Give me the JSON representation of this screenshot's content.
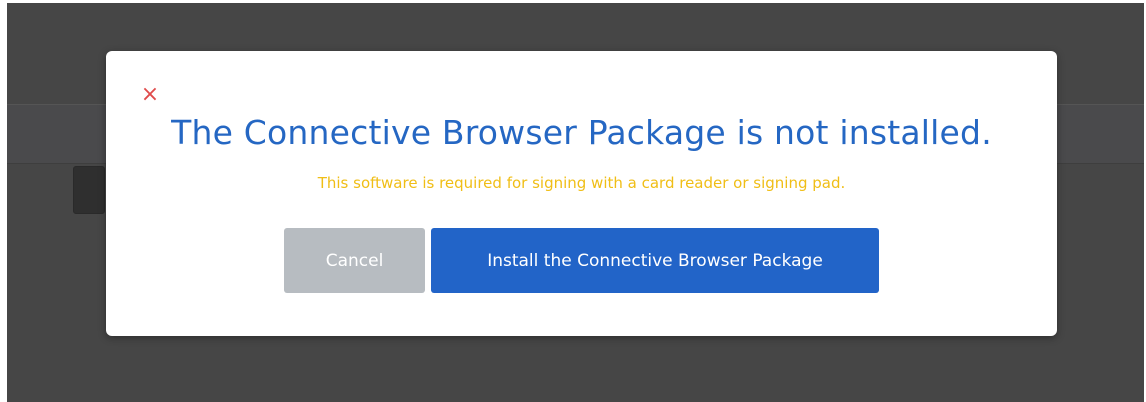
{
  "dialog": {
    "close_glyph": "×",
    "title": "The Connective Browser Package is not installed.",
    "message": "This software is required for signing with a card reader or signing pad.",
    "cancel_label": "Cancel",
    "install_label": "Install the Connective Browser Package"
  },
  "colors": {
    "overlay": "#464646",
    "title": "#2567c3",
    "message": "#f0be16",
    "close": "#e04b4b",
    "cancel_button": "#b7bcc1",
    "install_button": "#2264c8"
  },
  "icons": {
    "close": "close-icon"
  }
}
